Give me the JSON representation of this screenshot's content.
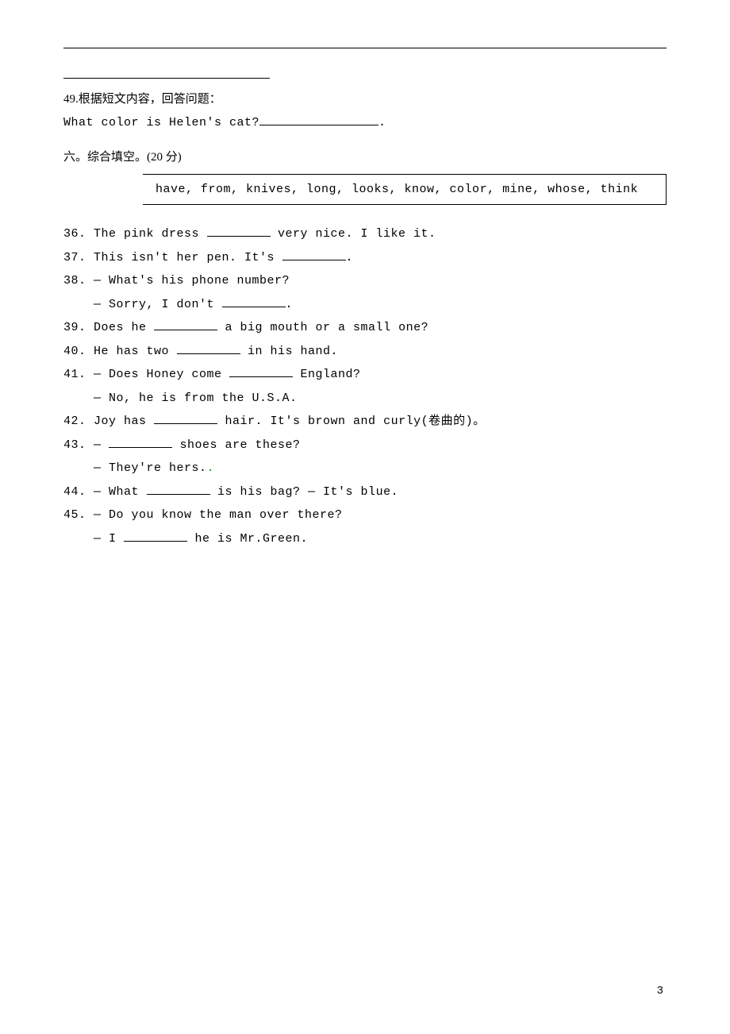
{
  "q49": {
    "prompt_cn": "49.根据短文内容，回答问题：",
    "question": "What color is Helen's cat?",
    "trail_punct": "."
  },
  "section6": {
    "heading": "六。综合填空。(20 分)",
    "word_bank": "have, from, knives, long, looks, know, color, mine, whose, think"
  },
  "fills": {
    "q36": {
      "pre": "36. The pink dress ",
      "post": " very nice. I like it."
    },
    "q37": {
      "pre": "37. This isn't her pen. It's ",
      "post": "."
    },
    "q38a": {
      "pre": "38. — What's his phone number?"
    },
    "q38b": {
      "pre": "— Sorry, I don't ",
      "post": "."
    },
    "q39": {
      "pre": "39. Does he ",
      "post": " a big mouth or a small one?"
    },
    "q40": {
      "pre": "40. He has two ",
      "post": " in his hand."
    },
    "q41a": {
      "pre": "41. — Does Honey come ",
      "post": " England?"
    },
    "q41b": {
      "text": "— No, he is from the U.S.A."
    },
    "q42": {
      "pre": "42. Joy has ",
      "post": " hair. It's brown and curly(卷曲的)。"
    },
    "q43a": {
      "pre": "43. — ",
      "post": " shoes are these?"
    },
    "q43b": {
      "text": "— They're hers.",
      "dot": "."
    },
    "q44": {
      "pre": "44. — What ",
      "post": " is his bag? — It's blue."
    },
    "q45a": {
      "pre": "45. — Do you know the man over there?"
    },
    "q45b": {
      "pre": "— I ",
      "post": " he is Mr.Green."
    }
  },
  "page_number": "3"
}
